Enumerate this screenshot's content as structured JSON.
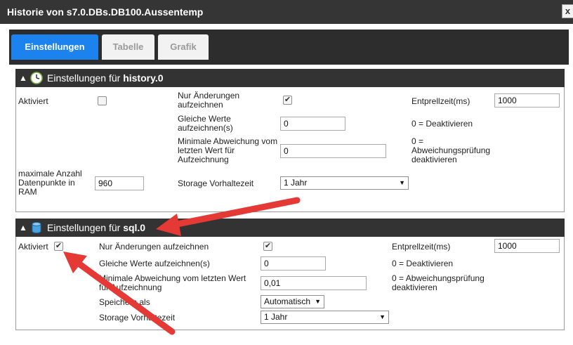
{
  "window": {
    "title": "Historie von s7.0.DBs.DB100.Aussentemp",
    "close_label": "x"
  },
  "tabs": [
    {
      "label": "Einstellungen"
    },
    {
      "label": "Tabelle"
    },
    {
      "label": "Grafik"
    }
  ],
  "history": {
    "header_prefix": "Einstellungen für",
    "header_name": "history.0",
    "toggle": "▲",
    "enabled_label": "Aktiviert",
    "enabled": false,
    "changes_only_label": "Nur Änderungen aufzeichnen",
    "changes_only": true,
    "debounce_label": "Entprellzeit(ms)",
    "debounce_value": "1000",
    "same_values_label": "Gleiche Werte aufzeichnen(s)",
    "same_values_value": "0",
    "same_values_hint": "0 = Deaktivieren",
    "min_deviation_label": "Minimale Abweichung vom letzten Wert für Aufzeichnung",
    "min_deviation_value": "0",
    "min_deviation_hint": "0 = Abweichungsprüfung deaktivieren",
    "max_ram_label": "maximale Anzahl Datenpunkte in RAM",
    "max_ram_value": "960",
    "retention_label": "Storage Vorhaltezeit",
    "retention_value": "1 Jahr"
  },
  "sql": {
    "header_prefix": "Einstellungen für",
    "header_name": "sql.0",
    "toggle": "▲",
    "enabled_label": "Aktiviert",
    "enabled": true,
    "changes_only_label": "Nur Änderungen aufzeichnen",
    "changes_only": true,
    "debounce_label": "Entprellzeit(ms)",
    "debounce_value": "1000",
    "same_values_label": "Gleiche Werte aufzeichnen(s)",
    "same_values_value": "0",
    "same_values_hint": "0 = Deaktivieren",
    "min_deviation_label": "Minimale Abweichung vom letzten Wert für Aufzeichnung",
    "min_deviation_value": "0,01",
    "min_deviation_hint": "0 = Abweichungsprüfung deaktivieren",
    "store_as_label": "Speichern als",
    "store_as_value": "Automatisch",
    "retention_label": "Storage Vorhaltezeit",
    "retention_value": "1 Jahr"
  },
  "colors": {
    "titlebar": "#353535",
    "tab_active": "#1b82ee",
    "section_header": "#333333",
    "annotation_arrow": "#e53935"
  },
  "icons": {
    "history": "clock-icon",
    "sql": "database-icon"
  },
  "checkmark": "✔",
  "dropdown_arrow": "▼"
}
